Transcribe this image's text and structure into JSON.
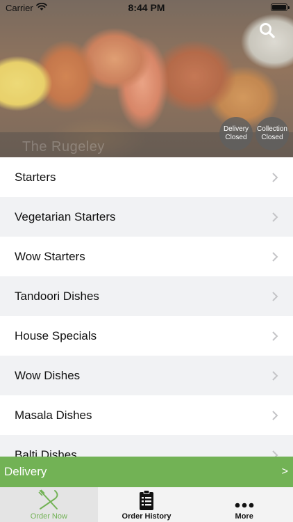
{
  "status_bar": {
    "carrier": "Carrier",
    "time": "8:44 PM"
  },
  "hero": {
    "restaurant_name": "The Rugeley",
    "search_icon": "search-icon",
    "badges": [
      {
        "line1": "Delivery",
        "line2": "Closed"
      },
      {
        "line1": "Collection",
        "line2": "Closed"
      }
    ]
  },
  "menu": {
    "items": [
      "Starters",
      "Vegetarian Starters",
      "Wow Starters",
      "Tandoori Dishes",
      "House Specials",
      "Wow Dishes",
      "Masala Dishes",
      "Balti Dishes"
    ]
  },
  "delivery_bar": {
    "label": "Delivery",
    "arrow": ">"
  },
  "tabs": [
    {
      "label": "Order Now",
      "icon": "fork-knife-icon",
      "active": true
    },
    {
      "label": "Order History",
      "icon": "order-list-icon",
      "active": false
    },
    {
      "label": "More",
      "icon": "more-dots-icon",
      "active": false
    }
  ],
  "colors": {
    "accent_green": "#72b255",
    "row_alt": "#f1f2f4",
    "badge_bg": "#5f5f5f"
  }
}
